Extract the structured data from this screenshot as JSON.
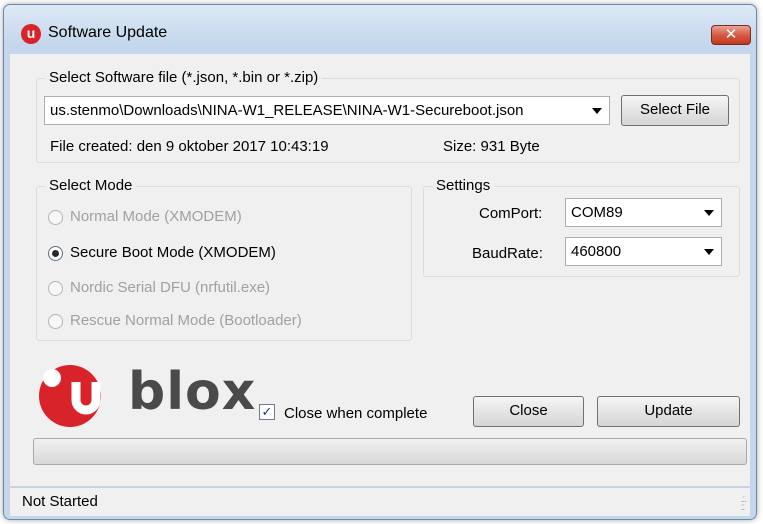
{
  "window": {
    "title": "Software Update",
    "app_icon": "u"
  },
  "file_group": {
    "label": "Select Software file (*.json, *.bin or *.zip)",
    "path_value": "us.stenmo\\Downloads\\NINA-W1_RELEASE\\NINA-W1-Secureboot.json",
    "select_button": "Select File",
    "file_created": "File created: den 9 oktober 2017 10:43:19",
    "size": "Size: 931 Byte"
  },
  "mode_group": {
    "label": "Select Mode",
    "options": [
      {
        "label": "Normal Mode (XMODEM)",
        "selected": false,
        "enabled": false
      },
      {
        "label": "Secure Boot Mode (XMODEM)",
        "selected": true,
        "enabled": true
      },
      {
        "label": "Nordic Serial DFU (nrfutil.exe)",
        "selected": false,
        "enabled": false
      },
      {
        "label": "Rescue Normal Mode (Bootloader)",
        "selected": false,
        "enabled": false
      }
    ]
  },
  "settings_group": {
    "label": "Settings",
    "comport_label": "ComPort:",
    "comport_value": "COM89",
    "baudrate_label": "BaudRate:",
    "baudrate_value": "460800"
  },
  "footer": {
    "logo_text": "blox",
    "logo_u": "u",
    "close_when_complete_label": "Close when complete",
    "close_when_complete_checked": true,
    "close_button": "Close",
    "update_button": "Update",
    "progress": 0
  },
  "status": {
    "text": "Not Started"
  },
  "colors": {
    "brand_red": "#d8232a",
    "logo_gray": "#4a4a4a"
  }
}
